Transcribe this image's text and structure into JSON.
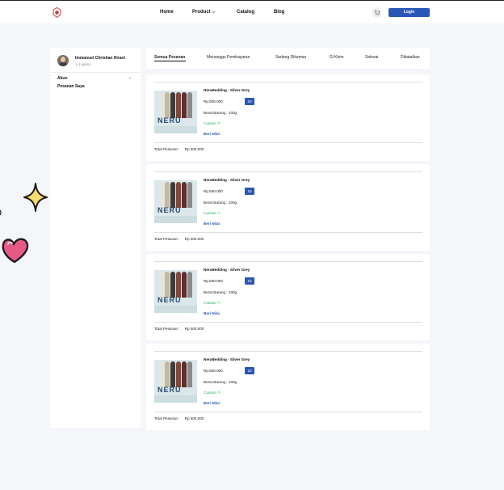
{
  "nav": {
    "links": [
      "Home",
      "Product",
      "Catalog",
      "Blog"
    ],
    "login_label": "Login"
  },
  "sidebar": {
    "user_name": "Immanuel Christian Hirani",
    "logout_label": "Logout",
    "account_label": "Akun",
    "orders_label": "Pesanan Saya"
  },
  "tabs": [
    "Semua Pesanan",
    "Menunggu Pembayaran",
    "Sedang Dikemas",
    "Di Kirim",
    "Selesai",
    "Dibatalkan"
  ],
  "orders": [
    {
      "product_name": "NeruBedding - Silver Grey",
      "price": "Rp.500.000",
      "quantity": "10",
      "weight": "Berat Barang : 100g",
      "note_label": "Catatan",
      "rate_label": "Beri Nilai",
      "total_label": "Total Pesanan :",
      "total_value": "Rp 500.000",
      "thumb_text": "NERU"
    },
    {
      "product_name": "NeruBedding - Silver Grey",
      "price": "Rp.500.000",
      "quantity": "10",
      "weight": "Berat Barang : 100g",
      "note_label": "Catatan",
      "rate_label": "Beri Nilai",
      "total_label": "Total Pesanan :",
      "total_value": "Rp 500.000",
      "thumb_text": "NERU"
    },
    {
      "product_name": "NeruBedding - Silver Grey",
      "price": "Rp.500.000",
      "quantity": "10",
      "weight": "Berat Barang : 100g",
      "note_label": "Catatan",
      "rate_label": "Beri Nilai",
      "total_label": "Total Pesanan :",
      "total_value": "Rp 500.000",
      "thumb_text": "NERU"
    },
    {
      "product_name": "NeruBedding - Silver Grey",
      "price": "Rp.500.000",
      "quantity": "10",
      "weight": "Berat Barang : 100g",
      "note_label": "Catatan",
      "rate_label": "Beri Nilai",
      "total_label": "Total Pesanan :",
      "total_value": "Rp 500.000",
      "thumb_text": "NERU"
    }
  ],
  "colors": {
    "accent": "#2a57b5",
    "note_green": "#34b26b",
    "star_yellow": "#f7dc6f",
    "heart_pink": "#e85a86"
  },
  "icons": {
    "logo": "brand-logo-icon",
    "cart": "cart-icon",
    "chevron": "chevron-down-icon",
    "logout": "logout-icon",
    "note": "pencil-icon"
  }
}
